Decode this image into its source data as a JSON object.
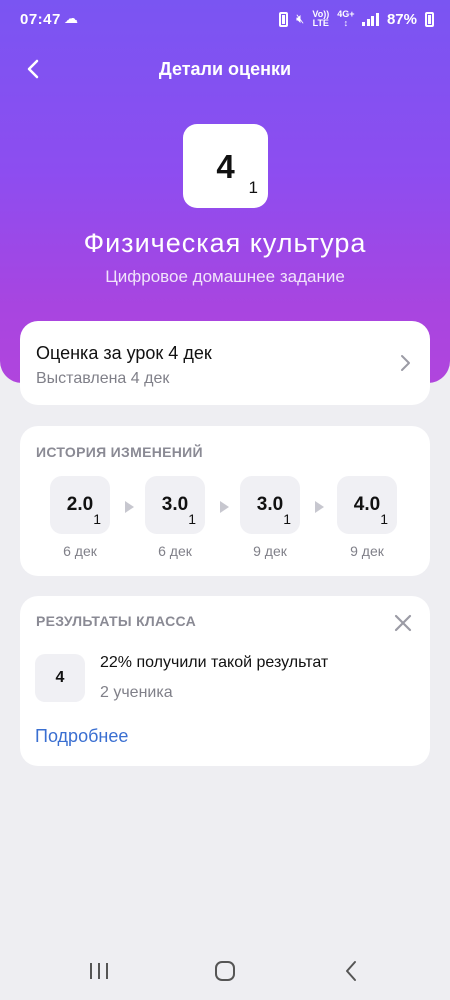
{
  "status_bar": {
    "time": "07:47",
    "volte_top": "Vo))",
    "volte_bottom": "LTE",
    "net_top": "4G+",
    "battery": "87%"
  },
  "header": {
    "title": "Детали оценки"
  },
  "grade": {
    "value": "4",
    "weight": "1",
    "subject": "Физическая культура",
    "work_type": "Цифровое домашнее задание"
  },
  "lesson": {
    "title": "Оценка за урок 4 дек",
    "subtitle": "Выставлена 4 дек"
  },
  "history": {
    "title": "ИСТОРИЯ ИЗМЕНЕНИЙ",
    "items": [
      {
        "value": "2.0",
        "weight": "1",
        "date": "6 дек"
      },
      {
        "value": "3.0",
        "weight": "1",
        "date": "6 дек"
      },
      {
        "value": "3.0",
        "weight": "1",
        "date": "9 дек"
      },
      {
        "value": "4.0",
        "weight": "1",
        "date": "9 дек"
      }
    ]
  },
  "results": {
    "title": "РЕЗУЛЬТАТЫ КЛАССА",
    "grade": "4",
    "percent_text": "22% получили такой результат",
    "count_text": "2 ученика",
    "more_label": "Подробнее"
  },
  "colors": {
    "accent": "#7a55f2",
    "link": "#3a6fd1"
  }
}
